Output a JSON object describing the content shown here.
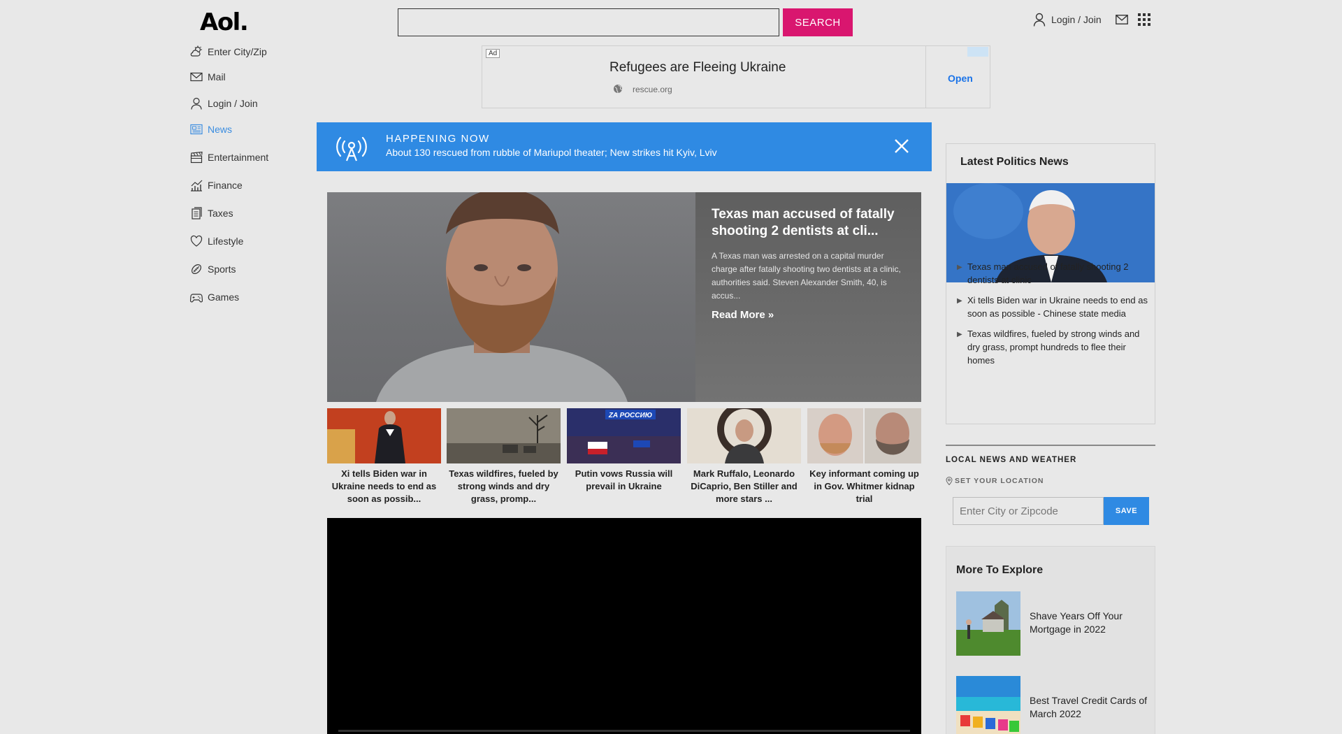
{
  "header": {
    "logo": "Aol.",
    "search_placeholder": "",
    "search_button": "SEARCH",
    "login_label": "Login / Join"
  },
  "sidebar": {
    "items": [
      {
        "label": "Enter City/Zip",
        "icon": "weather-icon",
        "active": false
      },
      {
        "label": "Mail",
        "icon": "mail-icon",
        "active": false
      },
      {
        "label": "Login / Join",
        "icon": "user-icon",
        "active": false
      },
      {
        "label": "News",
        "icon": "news-icon",
        "active": true
      },
      {
        "label": "Entertainment",
        "icon": "clapperboard-icon",
        "active": false
      },
      {
        "label": "Finance",
        "icon": "chart-icon",
        "active": false
      },
      {
        "label": "Taxes",
        "icon": "document-icon",
        "active": false
      },
      {
        "label": "Lifestyle",
        "icon": "heart-icon",
        "active": false
      },
      {
        "label": "Sports",
        "icon": "ball-icon",
        "active": false
      },
      {
        "label": "Games",
        "icon": "gamepad-icon",
        "active": false
      }
    ]
  },
  "ad": {
    "tag": "Ad",
    "title": "Refugees are Fleeing Ukraine",
    "domain": "rescue.org",
    "cta": "Open"
  },
  "happening": {
    "label": "HAPPENING NOW",
    "text": "About 130 rescued from rubble of Mariupol theater; New strikes hit Kyiv, Lviv"
  },
  "hero": {
    "title": "Texas man accused of fatally shooting 2 dentists at cli...",
    "description": "A Texas man was arrested on a capital murder charge after fatally shooting two dentists at a clinic, authorities said. Steven Alexander Smith, 40, is accus...",
    "read_more": "Read More »"
  },
  "thumbnails": [
    {
      "caption": "Xi tells Biden war in Ukraine needs to end as soon as possib..."
    },
    {
      "caption": "Texas wildfires, fueled by strong winds and dry grass, promp..."
    },
    {
      "caption": "Putin vows Russia will prevail in Ukraine",
      "overlay": "ZA РОССИЮ"
    },
    {
      "caption": "Mark Ruffalo, Leonardo DiCaprio, Ben Stiller and more stars ..."
    },
    {
      "caption": "Key informant coming up in Gov. Whitmer kidnap trial"
    }
  ],
  "politics": {
    "title": "Latest Politics News",
    "items": [
      "Texas man accused of fatally shooting 2 dentists at clinic",
      "Xi tells Biden war in Ukraine needs to end as soon as possible - Chinese state media",
      "Texas wildfires, fueled by strong winds and dry grass, prompt hundreds to flee their homes"
    ]
  },
  "local": {
    "title": "LOCAL NEWS AND WEATHER",
    "set_location": "SET YOUR LOCATION",
    "input_placeholder": "Enter City or Zipcode",
    "save_button": "SAVE"
  },
  "explore": {
    "title": "More To Explore",
    "items": [
      "Shave Years Off Your Mortgage in 2022",
      "Best Travel Credit Cards of March 2022"
    ]
  },
  "colors": {
    "accent_pink": "#d9166f",
    "accent_blue": "#2f8ae3",
    "active_nav": "#3b8de0",
    "background": "#e8e8e8"
  }
}
